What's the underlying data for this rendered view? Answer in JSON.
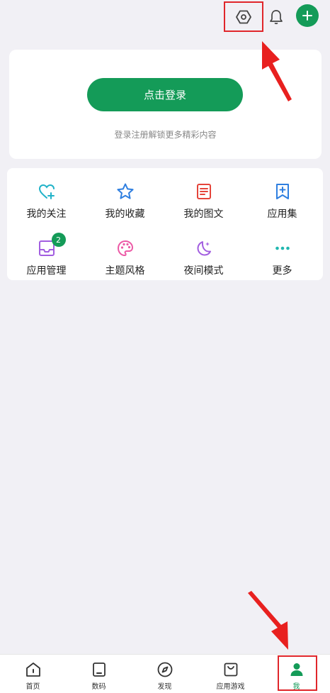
{
  "top_bar": {
    "icons": [
      "settings-icon",
      "bell-icon",
      "add-icon"
    ]
  },
  "login": {
    "button_label": "点击登录",
    "hint": "登录注册解锁更多精彩内容"
  },
  "grid": {
    "items": [
      {
        "label": "我的关注",
        "icon": "heart-plus-icon",
        "color": "#20b2c8"
      },
      {
        "label": "我的收藏",
        "icon": "star-icon",
        "color": "#2f7fe0"
      },
      {
        "label": "我的图文",
        "icon": "document-icon",
        "color": "#e5443a"
      },
      {
        "label": "应用集",
        "icon": "bookmark-plus-icon",
        "color": "#2f7fe0"
      },
      {
        "label": "应用管理",
        "icon": "inbox-icon",
        "color": "#a25ee0",
        "badge": "2"
      },
      {
        "label": "主题风格",
        "icon": "palette-icon",
        "color": "#ec5aa6"
      },
      {
        "label": "夜间模式",
        "icon": "moon-icon",
        "color": "#a25ee0"
      },
      {
        "label": "更多",
        "icon": "more-dots-icon",
        "color": "#21b7b0"
      }
    ]
  },
  "bottom_nav": {
    "items": [
      {
        "label": "首页",
        "icon": "home-icon"
      },
      {
        "label": "数码",
        "icon": "tablet-icon"
      },
      {
        "label": "发现",
        "icon": "compass-icon"
      },
      {
        "label": "应用游戏",
        "icon": "bag-icon"
      },
      {
        "label": "我",
        "icon": "user-icon",
        "active": true
      }
    ]
  },
  "colors": {
    "accent": "#149b58",
    "annotation": "#e0262b",
    "background": "#f1f0f5"
  }
}
